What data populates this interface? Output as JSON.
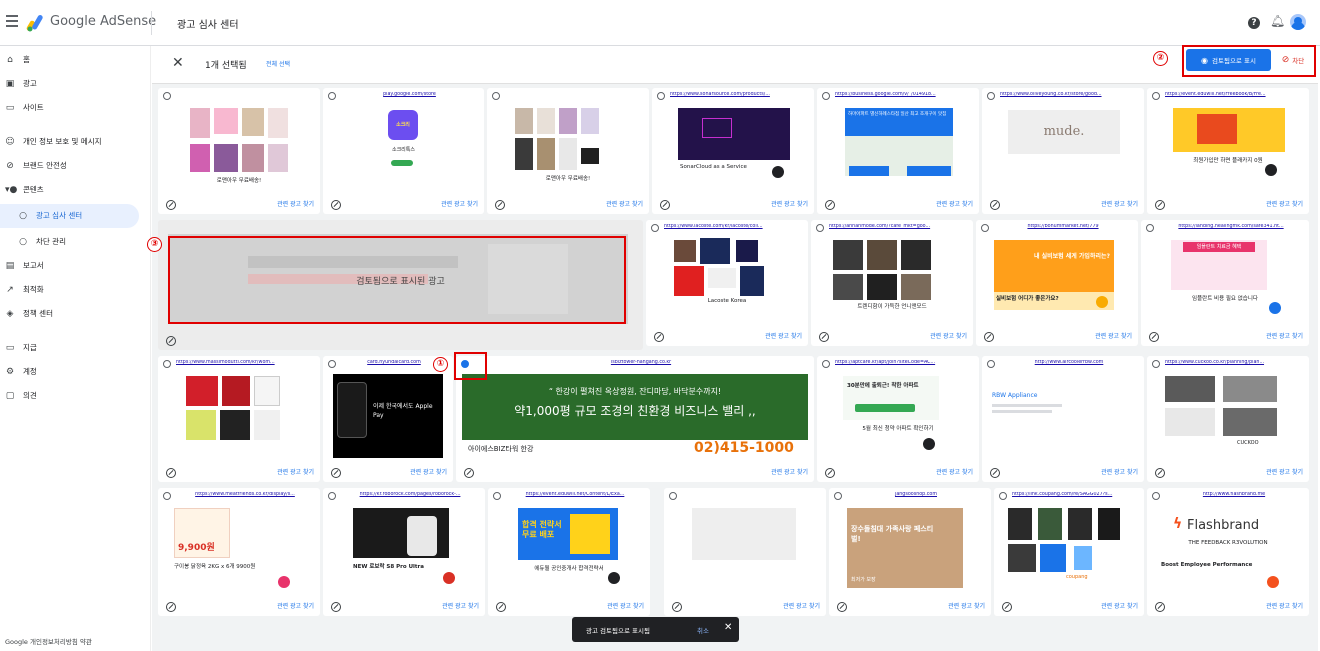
{
  "header": {
    "brand": "Google AdSense",
    "title": "광고 심사 센터"
  },
  "sidebar": {
    "items": [
      "홈",
      "광고",
      "사이트",
      "개인 정보 보호 및 메시지",
      "브랜드 안전성",
      "콘텐츠",
      "광고 심사 센터",
      "차단 관리",
      "보고서",
      "최적화",
      "정책 센터",
      "지급",
      "계정",
      "의견"
    ]
  },
  "footer": "Google 개인정보처리방침 약관",
  "selection": {
    "count": "1개 선택됨",
    "select_all": "전체 선택",
    "show_button": "검토됨으로 표시",
    "block_button": "차단"
  },
  "annotations": {
    "one": "①",
    "two": "②",
    "three": "③"
  },
  "rel_label": "관련 광고 찾기",
  "cards": {
    "c1": {
      "url": "",
      "cap": "로맨아우 무료배송!"
    },
    "c2": {
      "url": "play.google.com/store",
      "text": "소크리톡스"
    },
    "c3": {
      "url": "",
      "cap": "로맨아우 무료배송!"
    },
    "c4": {
      "url": "https://www.sonarsource.com/products/...",
      "cap": "SonarCloud as a Service"
    },
    "c5": {
      "url": "https://business.google.com/v/_/014918...",
      "text": "하마아파트 별신하례스타점 일산 최고 조개구이 맛집"
    },
    "c6": {
      "url": "https://www.oliveyoung.co.kr/store/good...",
      "text": "mude."
    },
    "c7": {
      "url": "https://event.eduwill.net/Freebook/B/Fre...",
      "cap": "최원가입만 하면 플래카지 0원"
    },
    "c8": {
      "text": "검토됨으로 표시된 광고"
    },
    "c9": {
      "url": "https://www.lacoste.com/kr/lacoste/coll...",
      "cap": "Lacoste Korea"
    },
    "c10": {
      "url": "https://annanmode.com/?cafe_mkt=goo...",
      "cap": "트렌디함이 가득한 언니앤모드"
    },
    "c11": {
      "url": "https://bohummarket.net/779",
      "text": "내 실비보험 세게 가입하리는?",
      "cap": "실비보험 어디가 좋은가요?"
    },
    "c12": {
      "url": "https://landing.healingmk.com/safe341.ht...",
      "text": "임플란트 치료금 혜택",
      "cap": "임플란트 비용 필요 없습니다"
    },
    "c13": {
      "url": "https://www.massimodutti.com/kr/wom...",
      "cap": "Massimo Dutti"
    },
    "c14": {
      "url": "card.hyundaicard.com",
      "text": "이제 한국에서도 Apple Pay"
    },
    "c15": {
      "url": "isbiztower-hangang.co.kr",
      "line1": "“ 한강이 펼쳐진 옥상정원, 잔디마당, 바닥분수까지!",
      "line2": "약1,000평 규모 조경의 친환경 비즈니스 밸리 ,,",
      "name": "아이에스BIZ타워 한강",
      "phone": "02)415-1000"
    },
    "c16": {
      "url": "https://aptcare.kr/apt/join?siteCode=AC...",
      "text": "30분만에 출퇴근! 착한 아파트",
      "cap": "5월 최신 청약 아파트 확인하기"
    },
    "c17": {
      "url": "http://www.aircoolerrbw.com",
      "text": "RBW Appliance"
    },
    "c18": {
      "url": "https://www.cuckoo.co.kr/planning/plan...",
      "cap": "CUCKOO"
    },
    "c19": {
      "url": "https://www.meatfriends.co.kr/display/s...",
      "text": "9,900원",
      "cap": "구이봉 닭정육 2KG x 6개 9900원"
    },
    "c20": {
      "url": "https://kr.roborock.com/pages/roborock-...",
      "cap": "NEW 로보락 S8 Pro Ultra"
    },
    "c21": {
      "url": "https://event.eduwill.net/Content/L/Exa...",
      "text": "합격 전략서 무료 배포",
      "cap": "에듀윌 공인중개사 합격전략서"
    },
    "c22": {
      "url": ""
    },
    "c23": {
      "url": "jangsooshop.com",
      "text": "장수돌침대 가족사랑 페스티벌!",
      "cap": "최저가 보장"
    },
    "c24": {
      "url": "https://link.coupang.com/re/SAGG027?s...",
      "cap": "coupang"
    },
    "c25": {
      "url": "http://www.flashbrand.me",
      "text": "Flashbrand",
      "sub": "THE FEEDBACK R3VOLUTION",
      "cap": "Boost Employee Performance"
    }
  },
  "toast": {
    "message": "광고 검토됨으로 표시됨",
    "undo": "취소"
  }
}
